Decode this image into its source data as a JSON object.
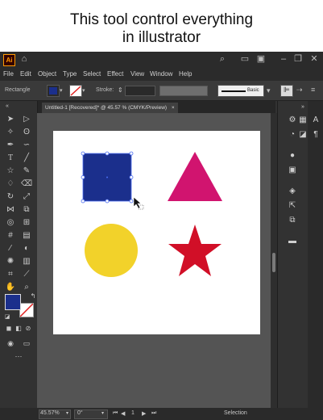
{
  "caption": {
    "line1": "This tool control everything",
    "line2": "in illustrator"
  },
  "app": {
    "logo": "Ai",
    "icons": [
      "home-icon",
      "search-icon",
      "arrange-documents-icon",
      "workspace-icon",
      "minimize-icon",
      "restore-icon",
      "close-icon"
    ],
    "glyphs": {
      "home": "⌂",
      "search": "⌕",
      "arrange": "▭",
      "workspace": "▣",
      "minimize": "–",
      "restore": "❐",
      "close": "✕"
    }
  },
  "menu": [
    "File",
    "Edit",
    "Object",
    "Type",
    "Select",
    "Effect",
    "View",
    "Window",
    "Help"
  ],
  "control_bar": {
    "selection_label": "Rectangle",
    "stroke_label": "Stroke:",
    "brush_label": "Basic",
    "fill_color": "#1b2f8c"
  },
  "document_tab": {
    "title": "Untitled-1 [Recovered]* @ 45.57 % (CMYK/Preview)",
    "close": "×"
  },
  "artboard": {
    "shapes": {
      "square_color": "#1b2f8c",
      "triangle_color": "#d1146f",
      "circle_color": "#f2d22a",
      "star_color": "#d10f27",
      "selection_color": "#4a6cf0"
    }
  },
  "status_bar": {
    "zoom": "45.57%",
    "rotation": "0°",
    "artboard_number": "1",
    "tool_name": "Selection"
  },
  "toolbar_swatches": {
    "fill": "#1b2f8c",
    "stroke": "#ffffff"
  }
}
